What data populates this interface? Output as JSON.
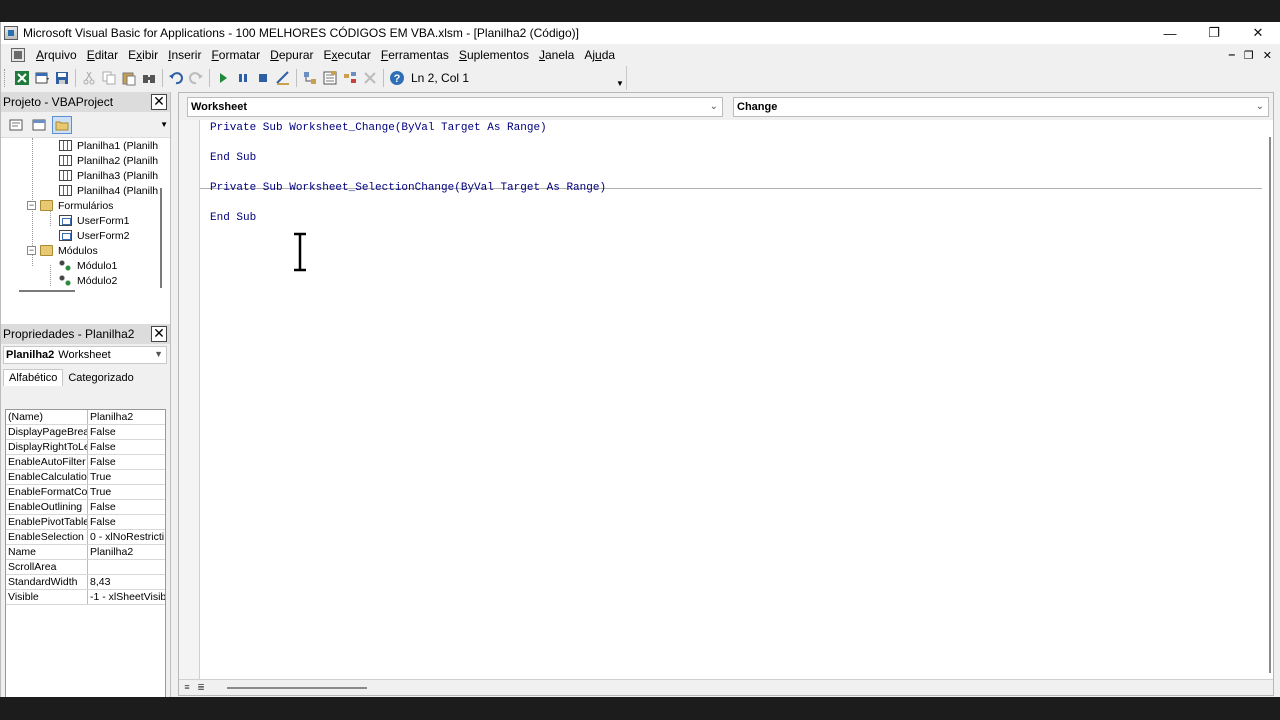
{
  "window": {
    "title": "Microsoft Visual Basic for Applications - 100 MELHORES CÓDIGOS EM VBA.xlsm - [Planilha2 (Código)]",
    "controls": {
      "minimize": "—",
      "restore": "❐",
      "close": "✕"
    }
  },
  "menu": {
    "items": [
      {
        "pre": "",
        "u": "A",
        "post": "rquivo"
      },
      {
        "pre": "",
        "u": "E",
        "post": "ditar"
      },
      {
        "pre": "E",
        "u": "x",
        "post": "ibir"
      },
      {
        "pre": "",
        "u": "I",
        "post": "nserir"
      },
      {
        "pre": "",
        "u": "F",
        "post": "ormatar"
      },
      {
        "pre": "",
        "u": "D",
        "post": "epurar"
      },
      {
        "pre": "E",
        "u": "x",
        "post": "ecutar"
      },
      {
        "pre": "",
        "u": "F",
        "post": "erramentas"
      },
      {
        "pre": "",
        "u": "S",
        "post": "uplementos"
      },
      {
        "pre": "",
        "u": "J",
        "post": "anela"
      },
      {
        "pre": "Aj",
        "u": "u",
        "post": "da"
      }
    ],
    "mdi_controls": {
      "minimize": "‒",
      "restore": "❐",
      "close": "✕"
    }
  },
  "toolbar": {
    "cursor_position": "Ln 2, Col 1",
    "icons": [
      "excel-icon",
      "insert-userform-icon",
      "save-icon",
      "cut-icon",
      "copy-icon",
      "paste-icon",
      "find-icon",
      "undo-icon",
      "redo-icon",
      "run-icon",
      "break-icon",
      "reset-icon",
      "design-mode-icon",
      "project-explorer-icon",
      "properties-icon",
      "object-browser-icon",
      "toolbox-icon",
      "help-icon"
    ]
  },
  "project_panel": {
    "title": "Projeto - VBAProject",
    "close": "✕",
    "tree": [
      {
        "label": "Planilha1 (Planilh",
        "type": "sheet",
        "level": 2
      },
      {
        "label": "Planilha2 (Planilh",
        "type": "sheet",
        "level": 2
      },
      {
        "label": "Planilha3 (Planilh",
        "type": "sheet",
        "level": 2
      },
      {
        "label": "Planilha4 (Planilh",
        "type": "sheet",
        "level": 2
      },
      {
        "label": "Formulários",
        "type": "folder",
        "level": 1,
        "expander": "−"
      },
      {
        "label": "UserForm1",
        "type": "form",
        "level": 2
      },
      {
        "label": "UserForm2",
        "type": "form",
        "level": 2
      },
      {
        "label": "Módulos",
        "type": "folder",
        "level": 1,
        "expander": "−"
      },
      {
        "label": "Módulo1",
        "type": "module",
        "level": 2
      },
      {
        "label": "Módulo2",
        "type": "module",
        "level": 2
      }
    ]
  },
  "properties_panel": {
    "title": "Propriedades - Planilha2",
    "close": "✕",
    "object_name": "Planilha2",
    "object_type": "Worksheet",
    "tabs": [
      "Alfabético",
      "Categorizado"
    ],
    "rows": [
      {
        "name": "(Name)",
        "value": "Planilha2"
      },
      {
        "name": "DisplayPageBreak",
        "value": "False"
      },
      {
        "name": "DisplayRightToLef",
        "value": "False"
      },
      {
        "name": "EnableAutoFilter",
        "value": "False"
      },
      {
        "name": "EnableCalculation",
        "value": "True"
      },
      {
        "name": "EnableFormatCon",
        "value": "True"
      },
      {
        "name": "EnableOutlining",
        "value": "False"
      },
      {
        "name": "EnablePivotTable",
        "value": "False"
      },
      {
        "name": "EnableSelection",
        "value": "0 - xlNoRestricti"
      },
      {
        "name": "Name",
        "value": "Planilha2"
      },
      {
        "name": "ScrollArea",
        "value": ""
      },
      {
        "name": "StandardWidth",
        "value": "8,43"
      },
      {
        "name": "Visible",
        "value": "-1 - xlSheetVisib"
      }
    ]
  },
  "code_window": {
    "object_combo": "Worksheet",
    "procedure_combo": "Change",
    "lines": [
      "Private Sub Worksheet_Change(ByVal Target As Range)",
      "",
      "End Sub",
      "",
      "Private Sub Worksheet_SelectionChange(ByVal Target As Range)",
      "",
      "End Sub"
    ]
  }
}
